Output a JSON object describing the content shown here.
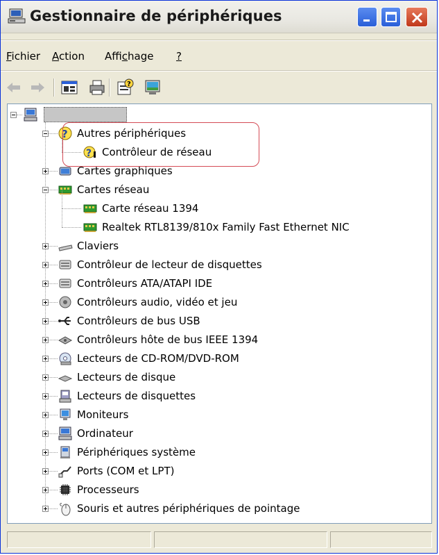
{
  "window": {
    "title": "Gestionnaire de périphériques"
  },
  "menu": [
    {
      "pre": "",
      "u": "F",
      "post": "ichier"
    },
    {
      "pre": "",
      "u": "A",
      "post": "ction"
    },
    {
      "pre": "Affi",
      "u": "c",
      "post": "hage"
    },
    {
      "pre": "",
      "u": "?",
      "post": ""
    }
  ],
  "toolbar": [
    "back-arrow-icon",
    "forward-arrow-icon",
    "properties-icon",
    "print-icon",
    "help-icon",
    "scan-hardware-icon"
  ],
  "tree": {
    "root_label": "",
    "items": [
      {
        "label": "Autres périphériques",
        "icon": "unknown-device-icon",
        "expanded": true
      },
      {
        "label": "Contrôleur de réseau",
        "icon": "warning-device-icon",
        "child": true
      },
      {
        "label": "Cartes graphiques",
        "icon": "display-adapter-icon",
        "expanded": false
      },
      {
        "label": "Cartes réseau",
        "icon": "network-adapter-icon",
        "expanded": true
      },
      {
        "label": "Carte réseau 1394",
        "icon": "network-adapter-icon",
        "child": true
      },
      {
        "label": "Realtek RTL8139/810x Family Fast Ethernet NIC",
        "icon": "network-adapter-icon",
        "child": true
      },
      {
        "label": "Claviers",
        "icon": "keyboard-icon",
        "expanded": false
      },
      {
        "label": "Contrôleur de lecteur de disquettes",
        "icon": "floppy-controller-icon",
        "expanded": false
      },
      {
        "label": "Contrôleurs ATA/ATAPI IDE",
        "icon": "ide-controller-icon",
        "expanded": false
      },
      {
        "label": "Contrôleurs audio, vidéo et jeu",
        "icon": "audio-icon",
        "expanded": false
      },
      {
        "label": "Contrôleurs de bus USB",
        "icon": "usb-icon",
        "expanded": false
      },
      {
        "label": "Contrôleurs hôte de bus IEEE 1394",
        "icon": "ieee1394-icon",
        "expanded": false
      },
      {
        "label": "Lecteurs de CD-ROM/DVD-ROM",
        "icon": "cdrom-icon",
        "expanded": false
      },
      {
        "label": "Lecteurs de disque",
        "icon": "disk-drive-icon",
        "expanded": false
      },
      {
        "label": "Lecteurs de disquettes",
        "icon": "floppy-drive-icon",
        "expanded": false
      },
      {
        "label": "Moniteurs",
        "icon": "monitor-icon",
        "expanded": false
      },
      {
        "label": "Ordinateur",
        "icon": "computer-icon",
        "expanded": false
      },
      {
        "label": "Périphériques système",
        "icon": "system-device-icon",
        "expanded": false
      },
      {
        "label": "Ports (COM et LPT)",
        "icon": "port-icon",
        "expanded": false
      },
      {
        "label": "Processeurs",
        "icon": "processor-icon",
        "expanded": false
      },
      {
        "label": "Souris et autres périphériques de pointage",
        "icon": "mouse-icon",
        "expanded": false
      }
    ]
  },
  "colors": {
    "highlight": "#d44a55",
    "title_bar": "#ece9d8",
    "tree_border": "#7f9db9"
  }
}
